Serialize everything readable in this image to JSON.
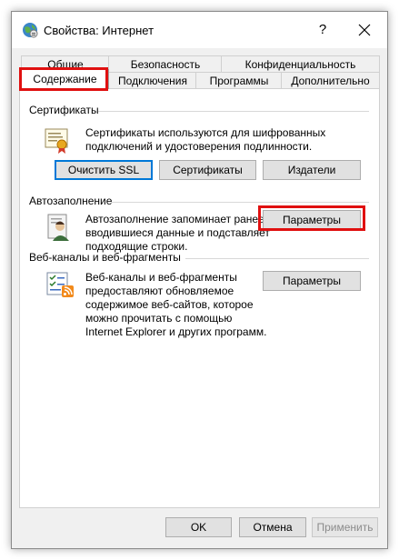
{
  "window": {
    "title": "Свойства: Интернет",
    "help_label": "?"
  },
  "tabs": {
    "row_back": [
      "Общие",
      "Безопасность",
      "Конфиденциальность"
    ],
    "row_front": [
      "Содержание",
      "Подключения",
      "Программы",
      "Дополнительно"
    ],
    "selected": "Содержание"
  },
  "certificates": {
    "title": "Сертификаты",
    "description": [
      "Сертификаты используются для шифрованных",
      "подключений и удостоверения подлинности."
    ],
    "buttons": [
      "Очистить SSL",
      "Сертификаты",
      "Издатели"
    ]
  },
  "autocomplete": {
    "title": "Автозаполнение",
    "description": [
      "Автозаполнение запоминает ранее",
      "вводившиеся данные и подставляет",
      "подходящие строки."
    ],
    "settings_label": "Параметры"
  },
  "feeds": {
    "title": "Веб-каналы и веб-фрагменты",
    "description": [
      "Веб-каналы и веб-фрагменты",
      "предоставляют обновляемое",
      "содержимое веб-сайтов, которое",
      "можно прочитать с помощью",
      "Internet Explorer и других программ."
    ],
    "settings_label": "Параметры"
  },
  "footer": {
    "ok_label": "OK",
    "cancel_label": "Отмена",
    "apply_label": "Применить"
  },
  "colors": {
    "highlight": "#e01010",
    "focus": "#0078d7"
  }
}
